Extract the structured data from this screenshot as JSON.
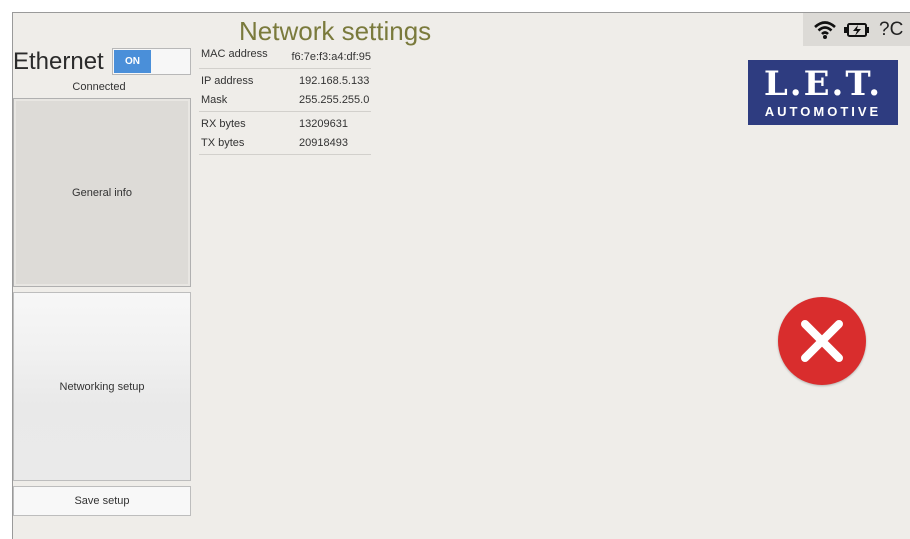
{
  "header": {
    "title": "Network settings"
  },
  "status_bar": {
    "icons": [
      "wifi-icon",
      "battery-charging-icon",
      "help-icon"
    ],
    "help_label": "?C"
  },
  "ethernet": {
    "label": "Ethernet",
    "toggle_label": "ON",
    "status": "Connected"
  },
  "sidebar": {
    "general_info": "General info",
    "networking_setup": "Networking setup",
    "save_setup": "Save setup"
  },
  "info": {
    "mac_label": "MAC address",
    "mac_value": "f6:7e:f3:a4:df:95",
    "ip_label": "IP address",
    "ip_value": "192.168.5.133",
    "mask_label": "Mask",
    "mask_value": "255.255.255.0",
    "rx_label": "RX bytes",
    "rx_value": "13209631",
    "tx_label": "TX bytes",
    "tx_value": "20918493"
  },
  "logo": {
    "line1": "L.E.T.",
    "line2": "AUTOMOTIVE"
  },
  "colors": {
    "accent": "#4a8fd9",
    "title": "#7a7a3c",
    "logo_bg": "#2e3c80",
    "close": "#d92d2d"
  }
}
